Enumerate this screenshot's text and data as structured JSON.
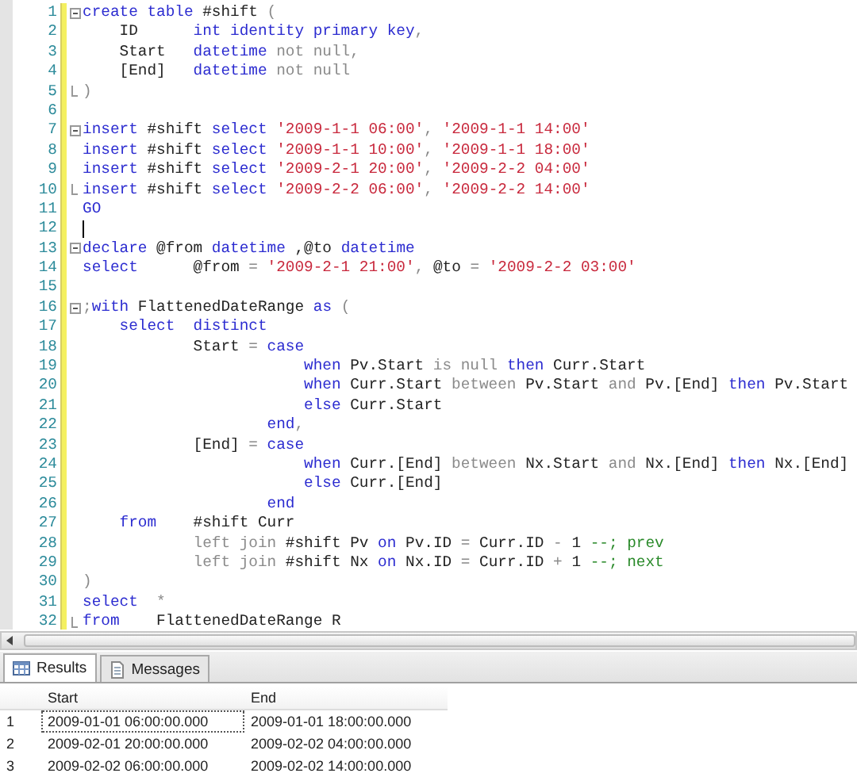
{
  "editor": {
    "lines": [
      {
        "number": "1",
        "kind": "open",
        "tokens": [
          {
            "kind": "keyword",
            "text": "create table"
          },
          {
            "kind": "plain",
            "text": " #shift "
          },
          {
            "kind": "gray",
            "text": "("
          }
        ]
      },
      {
        "number": "2",
        "kind": "code",
        "tokens": [
          {
            "kind": "plain",
            "text": "    ID      "
          },
          {
            "kind": "keyword",
            "text": "int identity primary key"
          },
          {
            "kind": "gray",
            "text": ","
          }
        ]
      },
      {
        "number": "3",
        "kind": "code",
        "tokens": [
          {
            "kind": "plain",
            "text": "    Start   "
          },
          {
            "kind": "keyword",
            "text": "datetime"
          },
          {
            "kind": "gray",
            "text": " not null,"
          }
        ]
      },
      {
        "number": "4",
        "kind": "code",
        "tokens": [
          {
            "kind": "plain",
            "text": "    [End]   "
          },
          {
            "kind": "keyword",
            "text": "datetime"
          },
          {
            "kind": "gray",
            "text": " not null"
          }
        ]
      },
      {
        "number": "5",
        "kind": "close",
        "tokens": [
          {
            "kind": "gray",
            "text": ")"
          }
        ]
      },
      {
        "number": "6",
        "kind": "code"
      },
      {
        "number": "7",
        "kind": "open",
        "tokens": [
          {
            "kind": "keyword",
            "text": "insert"
          },
          {
            "kind": "plain",
            "text": " #shift "
          },
          {
            "kind": "keyword",
            "text": "select "
          },
          {
            "kind": "string",
            "text": "'2009-1-1 06:00'"
          },
          {
            "kind": "gray",
            "text": ", "
          },
          {
            "kind": "string",
            "text": "'2009-1-1 14:00'"
          }
        ]
      },
      {
        "number": "8",
        "kind": "code",
        "tokens": [
          {
            "kind": "keyword",
            "text": "insert"
          },
          {
            "kind": "plain",
            "text": " #shift "
          },
          {
            "kind": "keyword",
            "text": "select "
          },
          {
            "kind": "string",
            "text": "'2009-1-1 10:00'"
          },
          {
            "kind": "gray",
            "text": ", "
          },
          {
            "kind": "string",
            "text": "'2009-1-1 18:00'"
          }
        ]
      },
      {
        "number": "9",
        "kind": "code",
        "tokens": [
          {
            "kind": "keyword",
            "text": "insert"
          },
          {
            "kind": "plain",
            "text": " #shift "
          },
          {
            "kind": "keyword",
            "text": "select "
          },
          {
            "kind": "string",
            "text": "'2009-2-1 20:00'"
          },
          {
            "kind": "gray",
            "text": ", "
          },
          {
            "kind": "string",
            "text": "'2009-2-2 04:00'"
          }
        ]
      },
      {
        "number": "10",
        "kind": "close",
        "tokens": [
          {
            "kind": "keyword",
            "text": "insert"
          },
          {
            "kind": "plain",
            "text": " #shift "
          },
          {
            "kind": "keyword",
            "text": "select "
          },
          {
            "kind": "string",
            "text": "'2009-2-2 06:00'"
          },
          {
            "kind": "gray",
            "text": ", "
          },
          {
            "kind": "string",
            "text": "'2009-2-2 14:00'"
          }
        ]
      },
      {
        "number": "11",
        "kind": "code",
        "tokens": [
          {
            "kind": "keyword",
            "text": "GO"
          }
        ]
      },
      {
        "number": "12",
        "kind": "code",
        "cursor": true
      },
      {
        "number": "13",
        "kind": "open",
        "tokens": [
          {
            "kind": "keyword",
            "text": "declare"
          },
          {
            "kind": "plain",
            "text": " @from "
          },
          {
            "kind": "keyword",
            "text": "datetime"
          },
          {
            "kind": "plain",
            "text": " ,@to "
          },
          {
            "kind": "keyword",
            "text": "datetime"
          }
        ]
      },
      {
        "number": "14",
        "kind": "code",
        "tokens": [
          {
            "kind": "keyword",
            "text": "select"
          },
          {
            "kind": "plain",
            "text": "      @from "
          },
          {
            "kind": "gray",
            "text": "= "
          },
          {
            "kind": "string",
            "text": "'2009-2-1 21:00'"
          },
          {
            "kind": "gray",
            "text": ", "
          },
          {
            "kind": "plain",
            "text": "@to "
          },
          {
            "kind": "gray",
            "text": "= "
          },
          {
            "kind": "string",
            "text": "'2009-2-2 03:00'"
          }
        ]
      },
      {
        "number": "15",
        "kind": "code"
      },
      {
        "number": "16",
        "kind": "open",
        "tokens": [
          {
            "kind": "gray",
            "text": ";"
          },
          {
            "kind": "keyword",
            "text": "with"
          },
          {
            "kind": "plain",
            "text": " FlattenedDateRange "
          },
          {
            "kind": "keyword",
            "text": "as"
          },
          {
            "kind": "gray",
            "text": " ("
          }
        ]
      },
      {
        "number": "17",
        "kind": "code",
        "tokens": [
          {
            "kind": "keyword",
            "text": "    select  distinct"
          }
        ]
      },
      {
        "number": "18",
        "kind": "code",
        "tokens": [
          {
            "kind": "plain",
            "text": "            Start "
          },
          {
            "kind": "gray",
            "text": "= "
          },
          {
            "kind": "keyword",
            "text": "case"
          }
        ]
      },
      {
        "number": "19",
        "kind": "code",
        "tokens": [
          {
            "kind": "keyword",
            "text": "                        when"
          },
          {
            "kind": "plain",
            "text": " Pv.Start "
          },
          {
            "kind": "gray",
            "text": "is null "
          },
          {
            "kind": "keyword",
            "text": "then"
          },
          {
            "kind": "plain",
            "text": " Curr.Start"
          }
        ]
      },
      {
        "number": "20",
        "kind": "code",
        "tokens": [
          {
            "kind": "keyword",
            "text": "                        when"
          },
          {
            "kind": "plain",
            "text": " Curr.Start "
          },
          {
            "kind": "gray",
            "text": "between"
          },
          {
            "kind": "plain",
            "text": " Pv.Start "
          },
          {
            "kind": "gray",
            "text": "and"
          },
          {
            "kind": "plain",
            "text": " Pv.[End] "
          },
          {
            "kind": "keyword",
            "text": "then"
          },
          {
            "kind": "plain",
            "text": " Pv.Start"
          }
        ]
      },
      {
        "number": "21",
        "kind": "code",
        "tokens": [
          {
            "kind": "keyword",
            "text": "                        else"
          },
          {
            "kind": "plain",
            "text": " Curr.Start"
          }
        ]
      },
      {
        "number": "22",
        "kind": "code",
        "tokens": [
          {
            "kind": "keyword",
            "text": "                    end"
          },
          {
            "kind": "gray",
            "text": ","
          }
        ]
      },
      {
        "number": "23",
        "kind": "code",
        "tokens": [
          {
            "kind": "plain",
            "text": "            [End] "
          },
          {
            "kind": "gray",
            "text": "= "
          },
          {
            "kind": "keyword",
            "text": "case"
          }
        ]
      },
      {
        "number": "24",
        "kind": "code",
        "tokens": [
          {
            "kind": "keyword",
            "text": "                        when"
          },
          {
            "kind": "plain",
            "text": " Curr.[End] "
          },
          {
            "kind": "gray",
            "text": "between"
          },
          {
            "kind": "plain",
            "text": " Nx.Start "
          },
          {
            "kind": "gray",
            "text": "and"
          },
          {
            "kind": "plain",
            "text": " Nx.[End] "
          },
          {
            "kind": "keyword",
            "text": "then"
          },
          {
            "kind": "plain",
            "text": " Nx.[End]"
          }
        ]
      },
      {
        "number": "25",
        "kind": "code",
        "tokens": [
          {
            "kind": "keyword",
            "text": "                        else"
          },
          {
            "kind": "plain",
            "text": " Curr.[End]"
          }
        ]
      },
      {
        "number": "26",
        "kind": "code",
        "tokens": [
          {
            "kind": "keyword",
            "text": "                    end"
          }
        ]
      },
      {
        "number": "27",
        "kind": "code",
        "tokens": [
          {
            "kind": "keyword",
            "text": "    from"
          },
          {
            "kind": "plain",
            "text": "    #shift Curr"
          }
        ]
      },
      {
        "number": "28",
        "kind": "code",
        "tokens": [
          {
            "kind": "gray",
            "text": "            left join"
          },
          {
            "kind": "plain",
            "text": " #shift Pv "
          },
          {
            "kind": "keyword",
            "text": "on"
          },
          {
            "kind": "plain",
            "text": " Pv.ID "
          },
          {
            "kind": "gray",
            "text": "="
          },
          {
            "kind": "plain",
            "text": " Curr.ID "
          },
          {
            "kind": "gray",
            "text": "-"
          },
          {
            "kind": "plain",
            "text": " 1 "
          },
          {
            "kind": "comment",
            "text": "--; prev"
          }
        ]
      },
      {
        "number": "29",
        "kind": "code",
        "tokens": [
          {
            "kind": "gray",
            "text": "            left join"
          },
          {
            "kind": "plain",
            "text": " #shift Nx "
          },
          {
            "kind": "keyword",
            "text": "on"
          },
          {
            "kind": "plain",
            "text": " Nx.ID "
          },
          {
            "kind": "gray",
            "text": "="
          },
          {
            "kind": "plain",
            "text": " Curr.ID "
          },
          {
            "kind": "gray",
            "text": "+"
          },
          {
            "kind": "plain",
            "text": " 1 "
          },
          {
            "kind": "comment",
            "text": "--; next"
          }
        ]
      },
      {
        "number": "30",
        "kind": "code",
        "tokens": [
          {
            "kind": "gray",
            "text": ")"
          }
        ]
      },
      {
        "number": "31",
        "kind": "code",
        "tokens": [
          {
            "kind": "keyword",
            "text": "select"
          },
          {
            "kind": "gray",
            "text": "  *"
          }
        ]
      },
      {
        "number": "32",
        "kind": "close",
        "tokens": [
          {
            "kind": "keyword",
            "text": "from"
          },
          {
            "kind": "plain",
            "text": "    FlattenedDateRange R"
          }
        ]
      }
    ]
  },
  "results": {
    "tabs": [
      {
        "label": "Results",
        "kind": "grid",
        "selected": true
      },
      {
        "label": "Messages",
        "kind": "messages",
        "selected": false
      }
    ],
    "columns": [
      "Start",
      "End"
    ],
    "rows": [
      {
        "number": "1",
        "cells": [
          "2009-01-01 06:00:00.000",
          "2009-01-01 18:00:00.000"
        ],
        "focused": true
      },
      {
        "number": "2",
        "cells": [
          "2009-02-01 20:00:00.000",
          "2009-02-02 04:00:00.000"
        ],
        "focused": false
      },
      {
        "number": "3",
        "cells": [
          "2009-02-02 06:00:00.000",
          "2009-02-02 14:00:00.000"
        ],
        "focused": false
      }
    ]
  }
}
